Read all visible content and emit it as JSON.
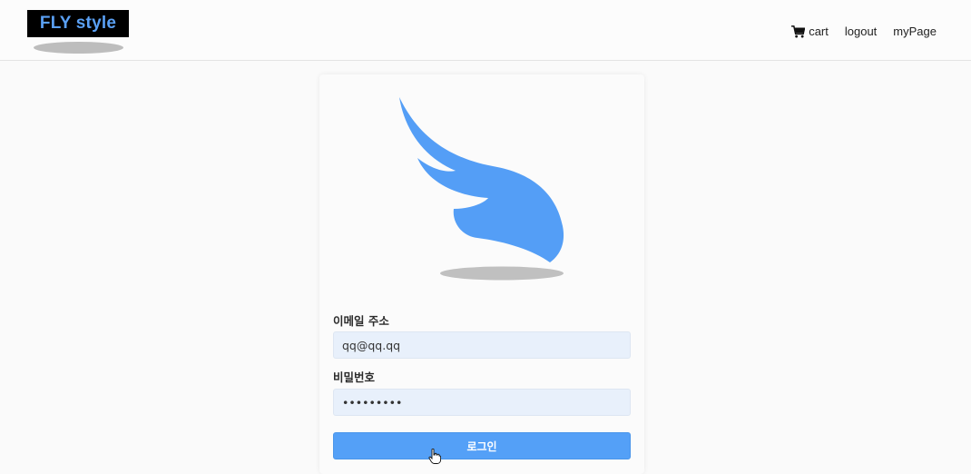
{
  "brand": {
    "logo_text": "FLY style",
    "accent_color": "#54a0f7"
  },
  "nav": {
    "items": [
      {
        "label": "cart",
        "icon": "cart-icon"
      },
      {
        "label": "logout"
      },
      {
        "label": "myPage"
      }
    ]
  },
  "login_form": {
    "logo_icon": "wing-logo-icon",
    "email_label": "이메일 주소",
    "email_value": "qq@qq.qq",
    "password_label": "비밀번호",
    "password_value": "•••••••••",
    "submit_label": "로그인"
  },
  "cursor": "hand-pointer-icon"
}
